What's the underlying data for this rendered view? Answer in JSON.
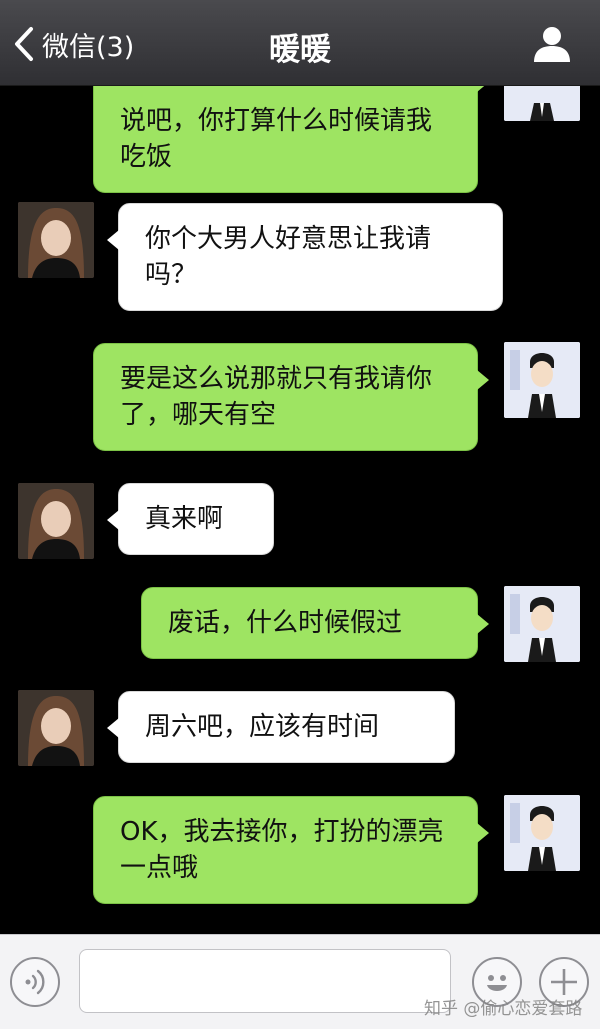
{
  "header": {
    "back_label": "微信(3)",
    "title": "暖暖"
  },
  "messages": [
    {
      "side": "out",
      "text": "说吧，你打算什么时候请我吃饭"
    },
    {
      "side": "in",
      "text": "你个大男人好意思让我请吗？"
    },
    {
      "side": "out",
      "text": "要是这么说那就只有我请你了，哪天有空"
    },
    {
      "side": "in",
      "text": "真来啊"
    },
    {
      "side": "out",
      "text": "废话，什么时候假过"
    },
    {
      "side": "in",
      "text": "周六吧，应该有时间"
    },
    {
      "side": "out",
      "text": "OK，我去接你，打扮的漂亮一点哦"
    }
  ],
  "input": {
    "value": ""
  },
  "watermark": "知乎 @偷心恋爱套路",
  "colors": {
    "header_bg": "#3c3c40",
    "chat_bg": "#000000",
    "out_bubble": "#9ee462",
    "in_bubble": "#ffffff",
    "input_bar_bg": "#f3f3f5"
  },
  "icons": {
    "back": "chevron-left-icon",
    "profile": "person-icon",
    "voice": "voice-icon",
    "emoji": "smiley-icon",
    "plus": "plus-icon"
  }
}
